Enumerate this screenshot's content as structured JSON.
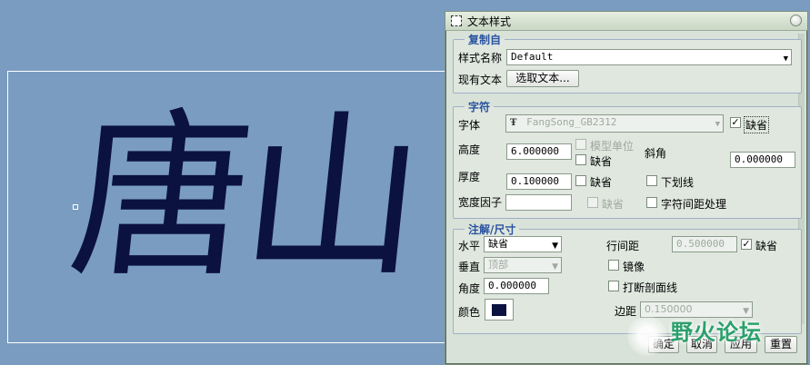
{
  "canvas": {
    "text": "唐山"
  },
  "dialog": {
    "title": "文本样式",
    "copy_from": {
      "legend": "复制自",
      "style_name_label": "样式名称",
      "style_name_value": "Default",
      "existing_text_label": "现有文本",
      "pick_text_button": "选取文本..."
    },
    "character": {
      "legend": "字符",
      "font_label": "字体",
      "font_value": "FangSong_GB2312",
      "font_default_label": "缺省",
      "font_default_checked": "✓",
      "height_label": "高度",
      "height_value": "6.000000",
      "model_units_label": "模型单位",
      "height_default_label": "缺省",
      "slant_label": "斜角",
      "slant_value": "0.000000",
      "thickness_label": "厚度",
      "thickness_value": "0.100000",
      "thickness_default_label": "缺省",
      "underline_label": "下划线",
      "width_factor_label": "宽度因子",
      "width_factor_default_label": "缺省",
      "kerning_label": "字符间距处理"
    },
    "annotation": {
      "legend": "注解/尺寸",
      "horizontal_label": "水平",
      "horizontal_value": "缺省",
      "line_spacing_label": "行间距",
      "line_spacing_value": "0.500000",
      "line_spacing_default_label": "缺省",
      "line_spacing_default_checked": "✓",
      "vertical_label": "垂直",
      "vertical_value": "顶部",
      "mirror_label": "镜像",
      "angle_label": "角度",
      "angle_value": "0.000000",
      "break_hatch_label": "打断剖面线",
      "color_label": "颜色",
      "margin_label": "边距",
      "margin_value": "0.150000"
    },
    "buttons": {
      "ok": "确定",
      "cancel": "取消",
      "apply": "应用",
      "reset": "重置"
    }
  },
  "watermark": {
    "text": "野火论坛"
  },
  "colors": {
    "background": "#7a9cc0",
    "text_color": "#0b1240",
    "legend_color": "#2a53a0"
  }
}
